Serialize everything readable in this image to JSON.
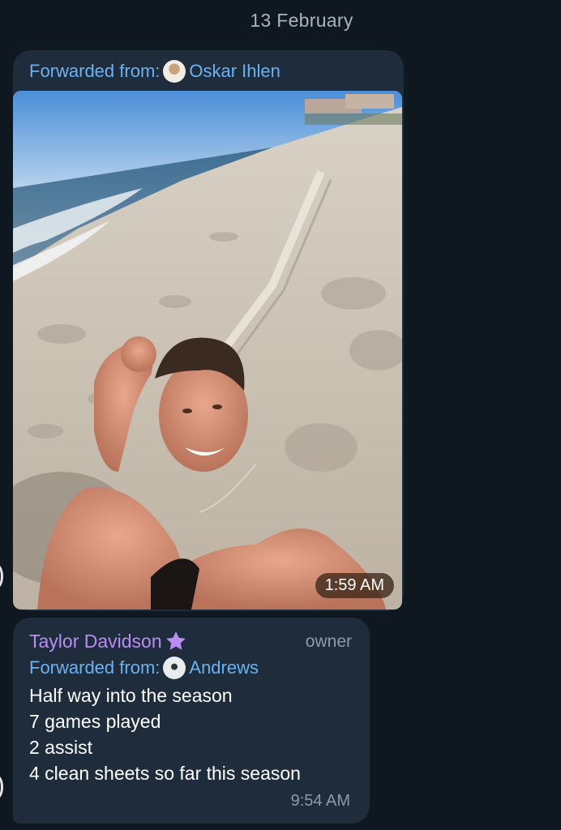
{
  "date_separator": "13 February",
  "messages": [
    {
      "forwarded_label": "Forwarded from:",
      "forwarded_from": "Oskar Ihlen",
      "forwarded_avatar_icon": "profile-photo",
      "photo_description_icon": "beach-selfie-photo",
      "time": "1:59 AM"
    },
    {
      "sender": "Taylor Davidson",
      "sender_badge_icon": "purple-star-icon",
      "role": "owner",
      "forwarded_label": "Forwarded from:",
      "forwarded_from": "Andrews",
      "forwarded_avatar_icon": "soccer-ball-avatar",
      "lines": [
        "Half way into the season",
        "7 games played",
        "2 assist",
        "4 clean sheets so far this season"
      ],
      "time": "9:54 AM"
    }
  ],
  "colors": {
    "background": "#0f1721",
    "bubble": "#1f2c3b",
    "link": "#6ab2f2",
    "sender_name": "#b98cf6",
    "meta": "#8e9aa8"
  }
}
